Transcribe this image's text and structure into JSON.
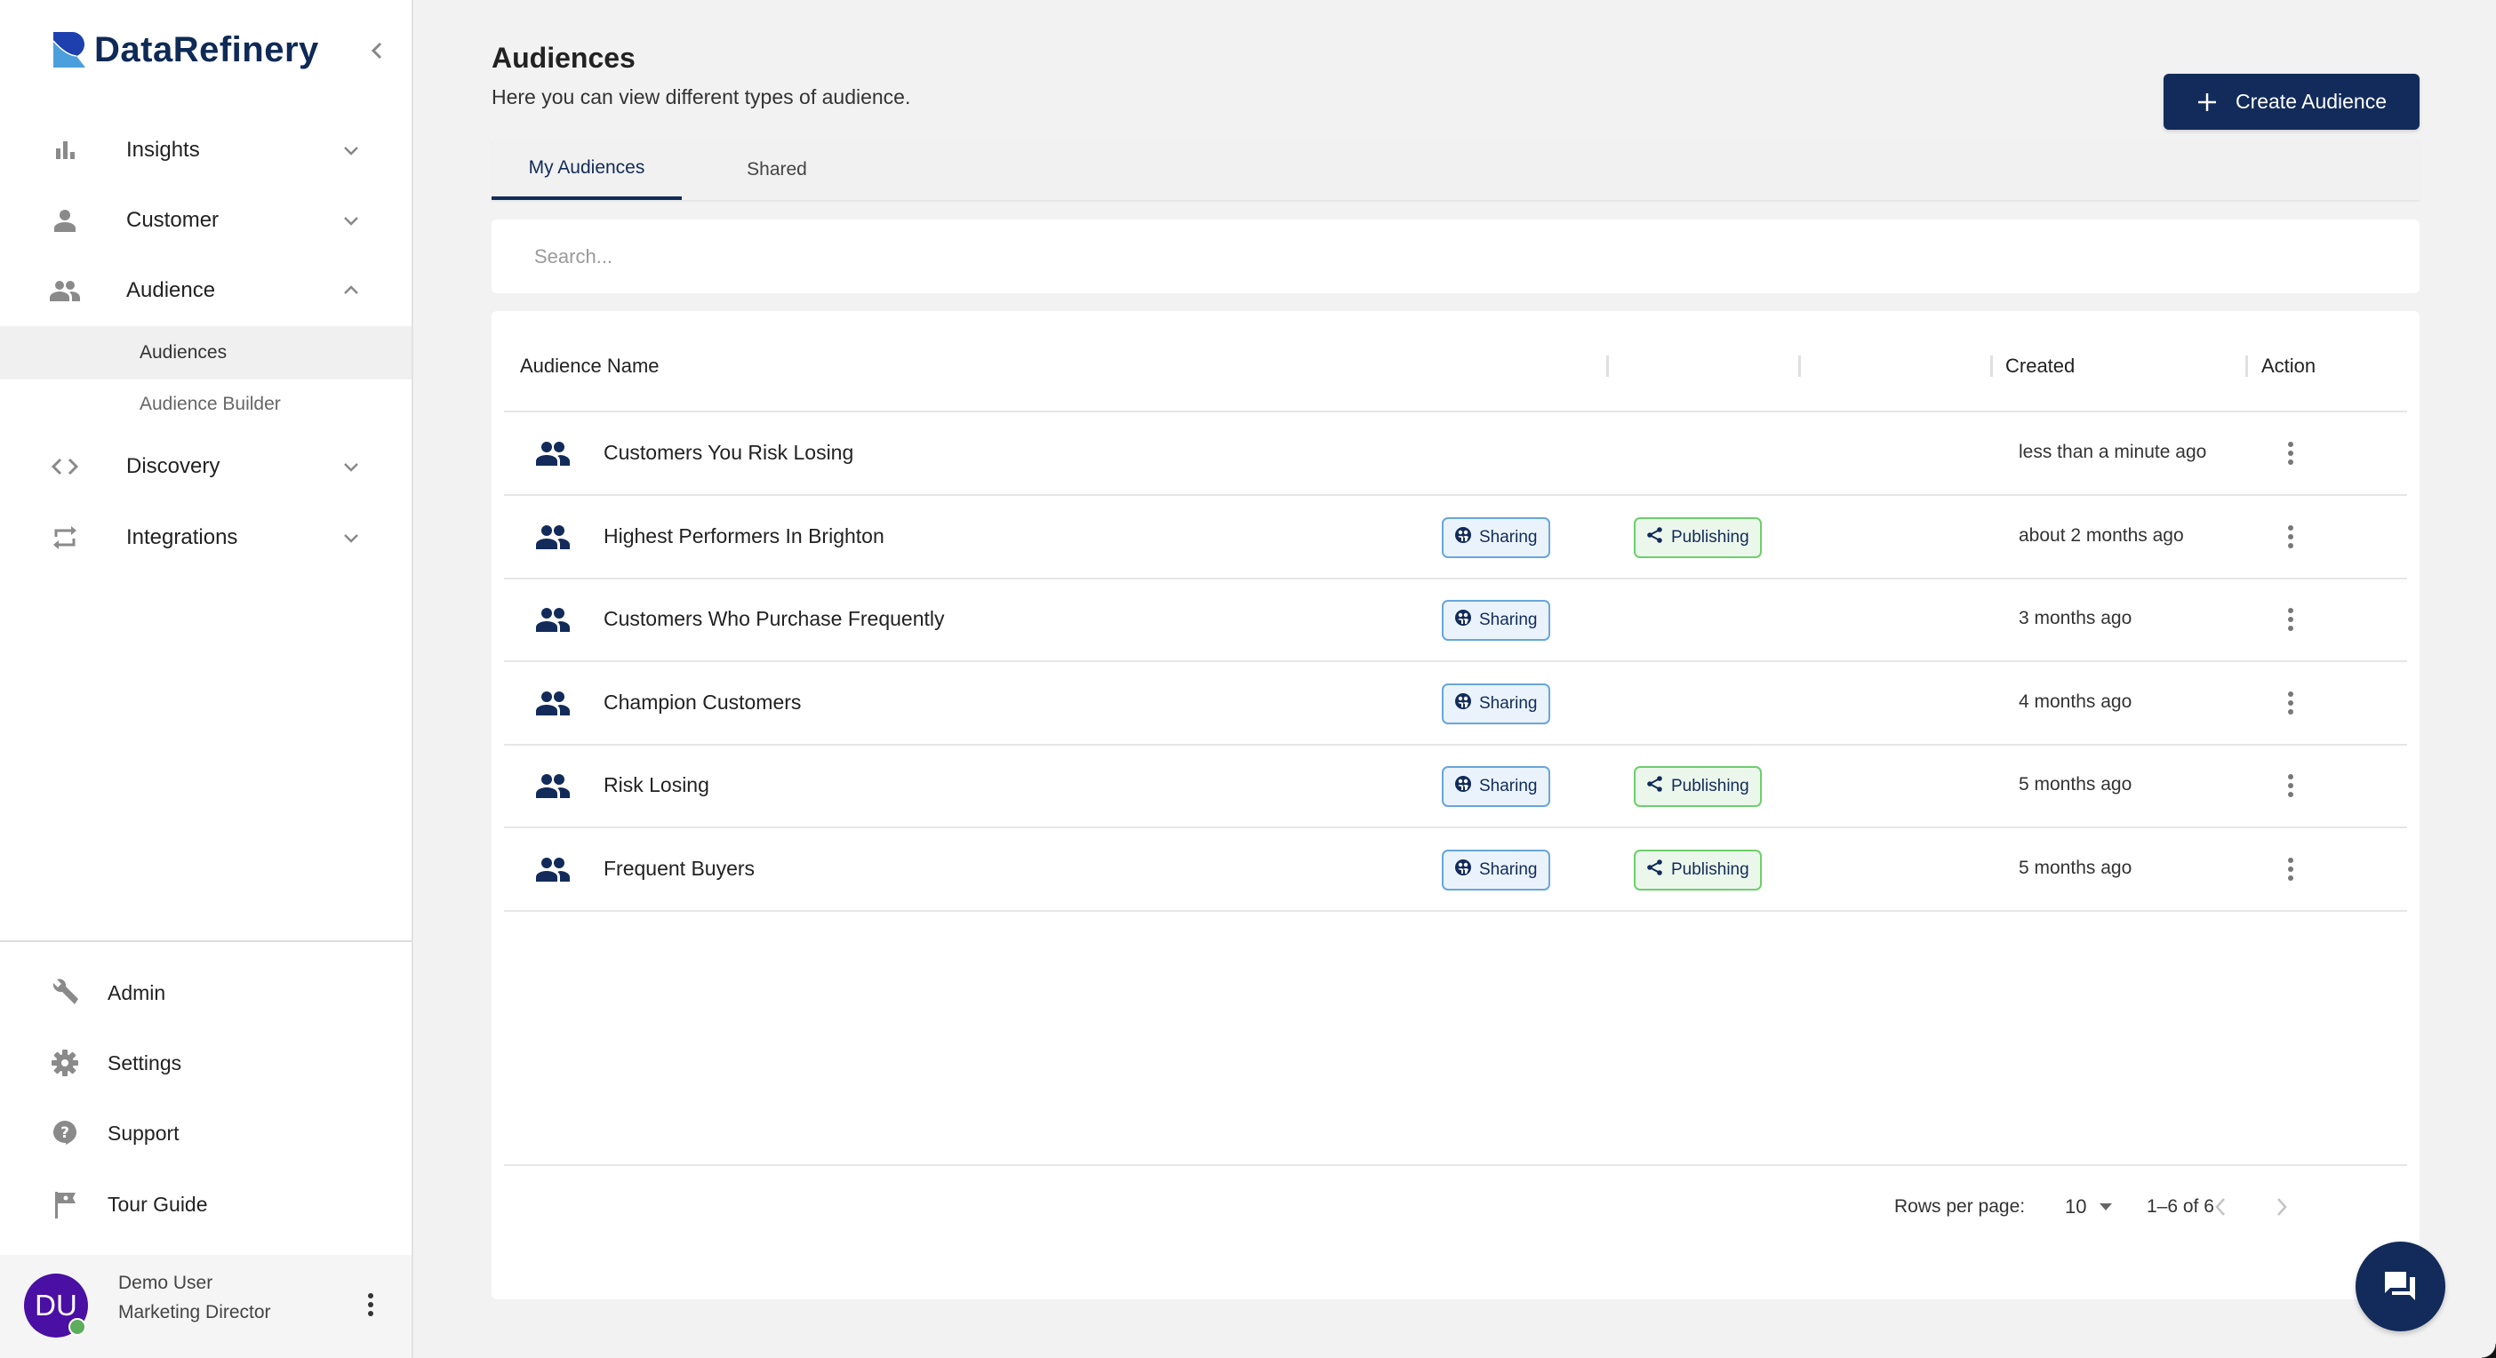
{
  "brand": {
    "name": "DataRefinery",
    "colors": {
      "primary": "#122b5a",
      "logo_dark": "#1e40af",
      "logo_light": "#4a9fdc",
      "avatar": "#4a0fa3",
      "online": "#5cad5c"
    }
  },
  "sidebar": {
    "collapse_icon": "chevron-left-icon",
    "nav": [
      {
        "label": "Insights",
        "icon": "bar-chart-icon",
        "expanded": false
      },
      {
        "label": "Customer",
        "icon": "person-icon",
        "expanded": false
      },
      {
        "label": "Audience",
        "icon": "people-icon",
        "expanded": true,
        "children": [
          {
            "label": "Audiences",
            "active": true
          },
          {
            "label": "Audience Builder",
            "active": false
          }
        ]
      },
      {
        "label": "Discovery",
        "icon": "code-icon",
        "expanded": false
      },
      {
        "label": "Integrations",
        "icon": "repeat-icon",
        "expanded": false
      }
    ],
    "bottom": [
      {
        "label": "Admin",
        "icon": "wrench-icon"
      },
      {
        "label": "Settings",
        "icon": "gear-icon"
      },
      {
        "label": "Support",
        "icon": "help-icon"
      },
      {
        "label": "Tour Guide",
        "icon": "flag-icon"
      }
    ],
    "user": {
      "initials": "DU",
      "name": "Demo User",
      "role": "Marketing Director",
      "status": "online"
    }
  },
  "header": {
    "title": "Audiences",
    "subtitle": "Here you can view different types of audience.",
    "create_button": "Create Audience"
  },
  "tabs": [
    {
      "label": "My Audiences",
      "active": true
    },
    {
      "label": "Shared",
      "active": false
    }
  ],
  "search": {
    "placeholder": "Search...",
    "value": ""
  },
  "table": {
    "columns": [
      "Audience Name",
      "",
      "",
      "Created",
      "Action"
    ],
    "rows": [
      {
        "name": "Customers You Risk Losing",
        "sharing": null,
        "publishing": null,
        "created": "less than a minute ago"
      },
      {
        "name": "Highest Performers In Brighton",
        "sharing": "Sharing",
        "publishing": "Publishing",
        "created": "about 2 months ago"
      },
      {
        "name": "Customers Who Purchase Frequently",
        "sharing": "Sharing",
        "publishing": null,
        "created": "3 months ago"
      },
      {
        "name": "Champion Customers",
        "sharing": "Sharing",
        "publishing": null,
        "created": "4 months ago"
      },
      {
        "name": "Risk Losing",
        "sharing": "Sharing",
        "publishing": "Publishing",
        "created": "5 months ago"
      },
      {
        "name": "Frequent Buyers",
        "sharing": "Sharing",
        "publishing": "Publishing",
        "created": "5 months ago"
      }
    ]
  },
  "pagination": {
    "rows_per_page_label": "Rows per page:",
    "rows_per_page": "10",
    "range": "1–6 of 6"
  }
}
